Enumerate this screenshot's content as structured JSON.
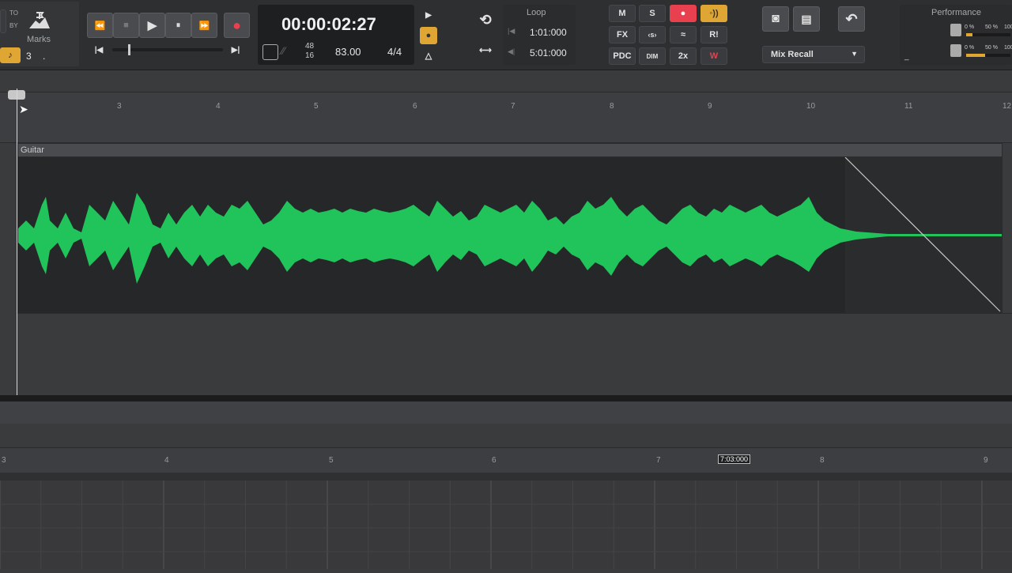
{
  "marks": {
    "to_label": "TO",
    "by_label": "BY",
    "marks_label": "Marks",
    "snap_value": "3",
    "dot": "."
  },
  "transport": {
    "rewind": "⏪",
    "stop": "■",
    "play": "▶",
    "pause": "⏸",
    "ffwd": "⏩",
    "record": "●",
    "go_start": "|◀",
    "go_end": "▶|"
  },
  "time": {
    "clock": "00:00:02:27",
    "time_sig_top": "48",
    "time_sig_bottom": "16",
    "tempo": "83.00",
    "meter": "4/4"
  },
  "loop": {
    "title": "Loop",
    "start": "1:01:000",
    "end": "5:01:000"
  },
  "mix": {
    "m": "M",
    "s": "S",
    "fx": "FX",
    "pdc": "PDC",
    "dim": "DIM",
    "speed": "2x",
    "ri": "R!",
    "mix_recall": "Mix Recall"
  },
  "performance": {
    "title": "Performance",
    "cpu1": "0 %",
    "cpu1b": "50 %",
    "cpu1c": "100",
    "cpu2": "0 %",
    "cpu2b": "50 %",
    "cpu2c": "100",
    "dash": "_"
  },
  "ruler_top": {
    "ticks": [
      "3",
      "4",
      "5",
      "6",
      "7",
      "8",
      "9",
      "10",
      "11",
      "12"
    ]
  },
  "track": {
    "clip_name": "Guitar"
  },
  "ruler_bottom": {
    "ticks": [
      "3",
      "4",
      "5",
      "6",
      "7",
      "8",
      "9"
    ],
    "cursor_time": "7:03:000"
  },
  "colors": {
    "waveform": "#20c45a",
    "record": "#e8404f",
    "accent": "#e0a634"
  }
}
